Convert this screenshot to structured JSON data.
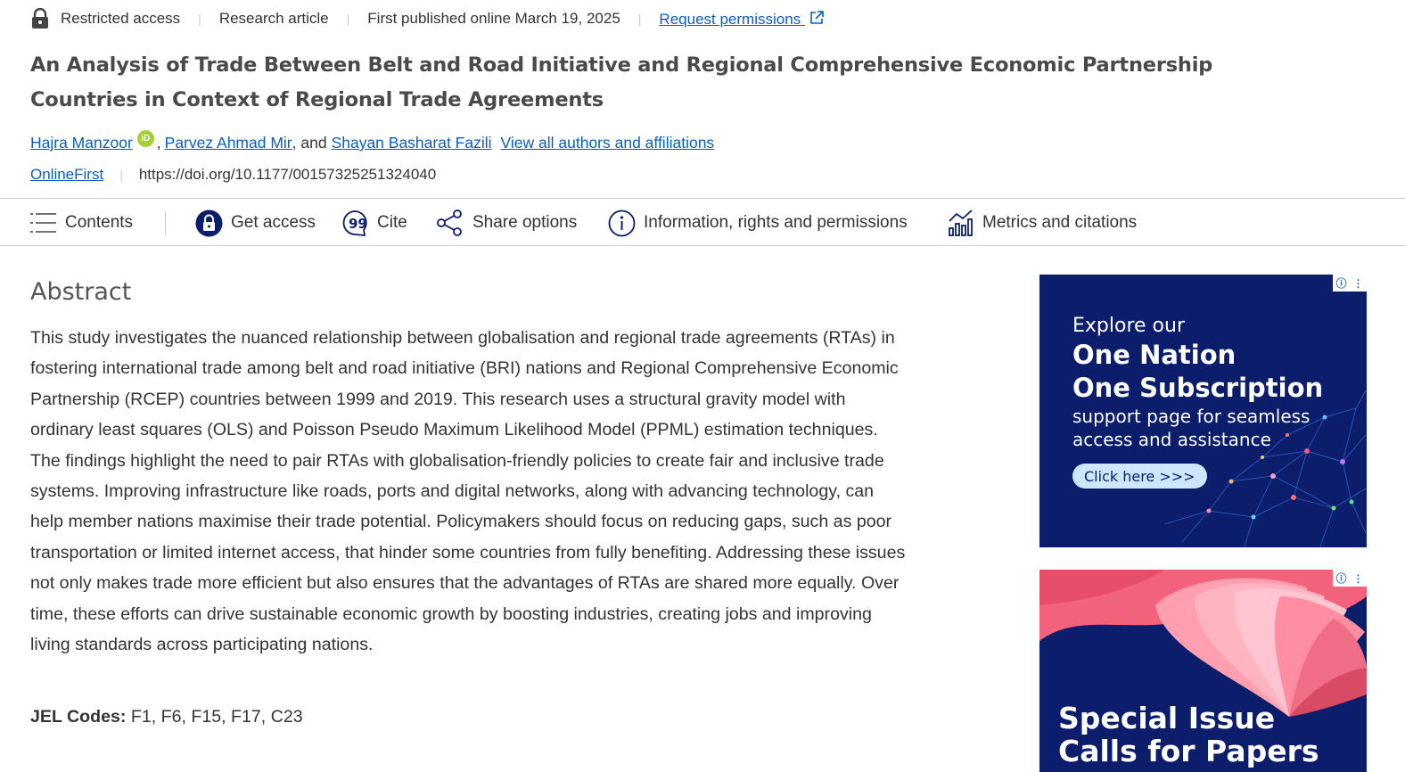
{
  "meta": {
    "access": "Restricted access",
    "type": "Research article",
    "published": "First published online March 19, 2025",
    "permissions": "Request permissions"
  },
  "article": {
    "title": "An Analysis of Trade Between Belt and Road Initiative and Regional Comprehensive Economic Partnership Countries in Context of Regional Trade Agreements",
    "authors": [
      {
        "name": "Hajra Manzoor",
        "orcid": "iD"
      },
      {
        "name": "Parvez Ahmad Mir"
      },
      {
        "name": "Shayan Basharat Fazili"
      }
    ],
    "author_sep": ",",
    "author_and": ", and",
    "all_authors": "View all authors and affiliations",
    "online_first": "OnlineFirst",
    "doi": "https://doi.org/10.1177/00157325251324040"
  },
  "toolbar": {
    "contents": "Contents",
    "get_access": "Get access",
    "cite": "Cite",
    "share": "Share options",
    "info": "Information, rights and permissions",
    "metrics": "Metrics and citations"
  },
  "abstract": {
    "heading": "Abstract",
    "body": "This study investigates the nuanced relationship between globalisation and regional trade agreements (RTAs) in fostering international trade among belt and road initiative (BRI) nations and Regional Comprehensive Economic Partnership (RCEP) countries between 1999 and 2019. This research uses a structural gravity model with ordinary least squares (OLS) and Poisson Pseudo Maximum Likelihood Model (PPML) estimation techniques. The findings highlight the need to pair RTAs with globalisation-friendly policies to create fair and inclusive trade systems. Improving infrastructure like roads, ports and digital networks, along with advancing technology, can help member nations maximise their trade potential. Policymakers should focus on reducing gaps, such as poor transportation or limited internet access, that hinder some countries from fully benefiting. Addressing these issues not only makes trade more efficient but also ensures that the advantages of RTAs are shared more equally. Over time, these efforts can drive sustainable economic growth by boosting industries, creating jobs and improving living standards across participating nations.",
    "jel_label": "JEL Codes:",
    "jel_codes": " F1, F6, F15, F17, C23"
  },
  "ads": {
    "ad1": {
      "line1": "Explore our",
      "line2": "One Nation",
      "line3": "One Subscription",
      "line4": "support page for seamless",
      "line5": "access and assistance",
      "button": "Click here >>>"
    },
    "ad2": {
      "line1": "Special Issue",
      "line2": "Calls for Papers"
    },
    "info_glyph": "ⓘ",
    "menu_glyph": "⋮"
  },
  "colors": {
    "link": "#0a5ec0",
    "orcid": "#a6ce39",
    "ad_bg": "#0b1d6b",
    "ad_pink": "#f0607a"
  }
}
